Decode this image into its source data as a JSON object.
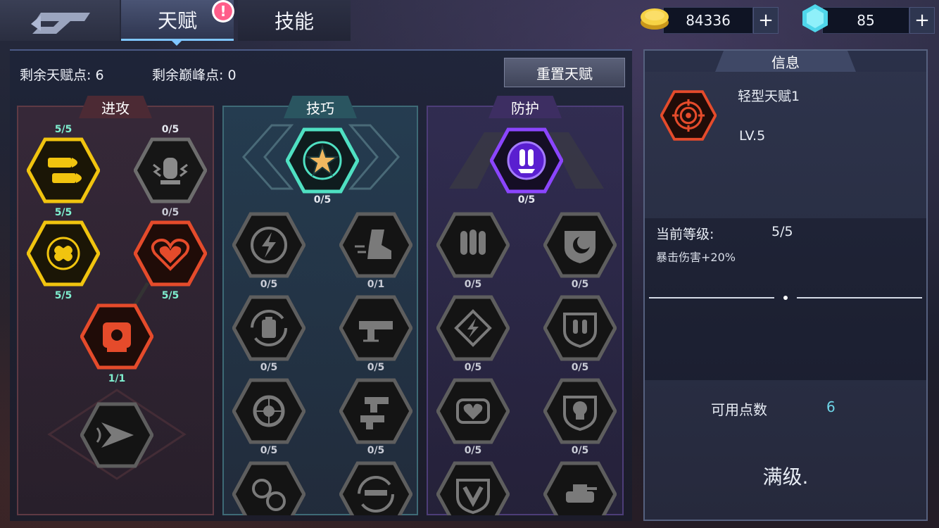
{
  "tabs": {
    "talent": "天赋",
    "skill": "技能"
  },
  "alert": "!",
  "currency": {
    "gold": {
      "value": "84336",
      "plus": "+",
      "icon": "gold-coin-icon"
    },
    "gem": {
      "value": "85",
      "plus": "+",
      "icon": "gem-icon"
    }
  },
  "points": {
    "remaining_talent": "剩余天赋点: 6",
    "remaining_peak": "剩余巅峰点: 0"
  },
  "reset_label": "重置天赋",
  "columns": {
    "attack": {
      "title": "进攻",
      "nodes": [
        {
          "level": "5/5",
          "icon": "bullets-icon",
          "color": "#f1c40f"
        },
        {
          "level": "0/5",
          "icon": "bullet-shock-icon",
          "color": "#8a8a8a"
        },
        {
          "level": "5/5",
          "icon": "crossed-bullets-icon",
          "color": "#f1c40f"
        },
        {
          "level": "0/5",
          "icon": "heart-icon",
          "color": "#e54b2b"
        },
        {
          "level": "5/5",
          "icon": "crosshair-icon",
          "color": "#e54b2b"
        },
        {
          "level": "5/5",
          "icon": "",
          "color": ""
        },
        {
          "level": "1/1",
          "icon": "shield-target-icon",
          "color": "#e54b2b"
        },
        {
          "level": "",
          "icon": "speed-arrow-icon",
          "color": "#8a8a8a"
        }
      ]
    },
    "skill": {
      "title": "技巧",
      "nodes": [
        {
          "level": "0/5",
          "icon": "star-icon"
        },
        {
          "level": "0/5",
          "icon": "lightning-cycle-icon"
        },
        {
          "level": "0/1",
          "icon": "boot-icon"
        },
        {
          "level": "0/5",
          "icon": "battery-cycle-icon"
        },
        {
          "level": "0/5",
          "icon": "machine-gun-icon"
        },
        {
          "level": "0/5",
          "icon": "wheel-icon"
        },
        {
          "level": "0/5",
          "icon": "turrets-icon"
        },
        {
          "level": "",
          "icon": "gears-icon"
        },
        {
          "level": "",
          "icon": "gun-cycle-icon"
        }
      ]
    },
    "defense": {
      "title": "防护",
      "nodes": [
        {
          "level": "0/5",
          "icon": "rocket-cycle-icon"
        },
        {
          "level": "0/5",
          "icon": "rockets-icon"
        },
        {
          "level": "0/5",
          "icon": "shield-moon-icon"
        },
        {
          "level": "0/5",
          "icon": "lightning-diamond-icon"
        },
        {
          "level": "0/5",
          "icon": "shield-rockets-icon"
        },
        {
          "level": "0/5",
          "icon": "heart-shield-icon"
        },
        {
          "level": "0/5",
          "icon": "skull-shield-icon"
        },
        {
          "level": "",
          "icon": "v-shield-icon"
        },
        {
          "level": "",
          "icon": "tank-icon"
        }
      ]
    }
  },
  "info": {
    "title": "信息",
    "talent_name": "轻型天赋1",
    "talent_level": "LV.5",
    "current_level_label": "当前等级:",
    "current_level_value": "5/5",
    "effect": "暴击伤害+20%",
    "available_points_label": "可用点数",
    "available_points_value": "6",
    "max_level_text": "满级."
  },
  "colors": {
    "accent_blue": "#7fc6ff",
    "gold": "#f1c40f",
    "red": "#e54b2b",
    "teal": "#4fe0c2",
    "purple": "#8b45ff",
    "points_value": "#6fd6e8"
  }
}
